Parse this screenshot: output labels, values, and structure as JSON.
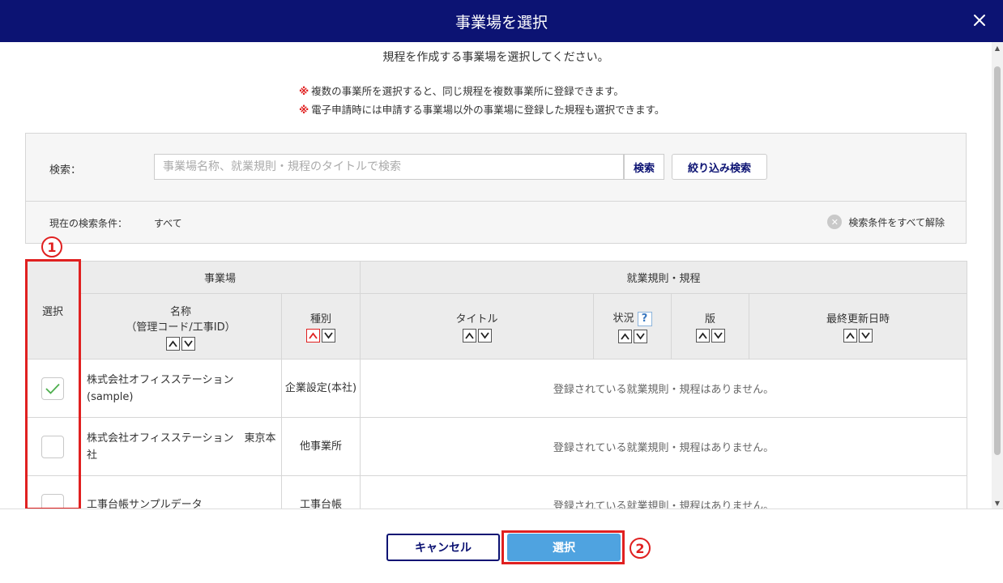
{
  "header": {
    "title": "事業場を選択",
    "close_icon": "close-icon"
  },
  "intro": "規程を作成する事業場を選択してください。",
  "notes": [
    {
      "mark": "※",
      "text": "複数の事業所を選択すると、同じ規程を複数事業所に登録できます。"
    },
    {
      "mark": "※",
      "text": "電子申請時には申請する事業場以外の事業場に登録した規程も選択できます。"
    }
  ],
  "search": {
    "label": "検索：",
    "placeholder": "事業場名称、就業規則・規程のタイトルで検索",
    "value": "",
    "search_button": "検索",
    "filter_button": "絞り込み検索",
    "condition_label": "現在の検索条件：",
    "condition_value": "すべて",
    "clear_all": "検索条件をすべて解除"
  },
  "annotations": {
    "marker1": "1",
    "marker2": "2",
    "color": "#e02020"
  },
  "table": {
    "select_header": "選択",
    "group_office": "事業場",
    "group_rules": "就業規則・規程",
    "col_name": "名称",
    "col_name_sub": "（管理コード/工事ID）",
    "col_kind": "種別",
    "col_title": "タイトル",
    "col_status": "状況",
    "col_status_help": "?",
    "col_version": "版",
    "col_updated": "最終更新日時",
    "rows": [
      {
        "checked": true,
        "name": "株式会社オフィスステーション",
        "name_sub": "(sample)",
        "kind": "企業設定(本社)",
        "rules": "登録されている就業規則・規程はありません。"
      },
      {
        "checked": false,
        "name": "株式会社オフィスステーション　東京本社",
        "name_sub": "",
        "kind": "他事業所",
        "rules": "登録されている就業規則・規程はありません。"
      },
      {
        "checked": false,
        "name": "工事台帳サンプルデータ",
        "name_sub": "",
        "kind": "工事台帳",
        "rules": "登録されている就業規則・規程はありません。"
      }
    ]
  },
  "footer": {
    "cancel": "キャンセル",
    "select": "選択"
  },
  "colors": {
    "header_bg": "#0c1373",
    "primary_btn": "#4fa3e0",
    "accent_red": "#e02020"
  }
}
